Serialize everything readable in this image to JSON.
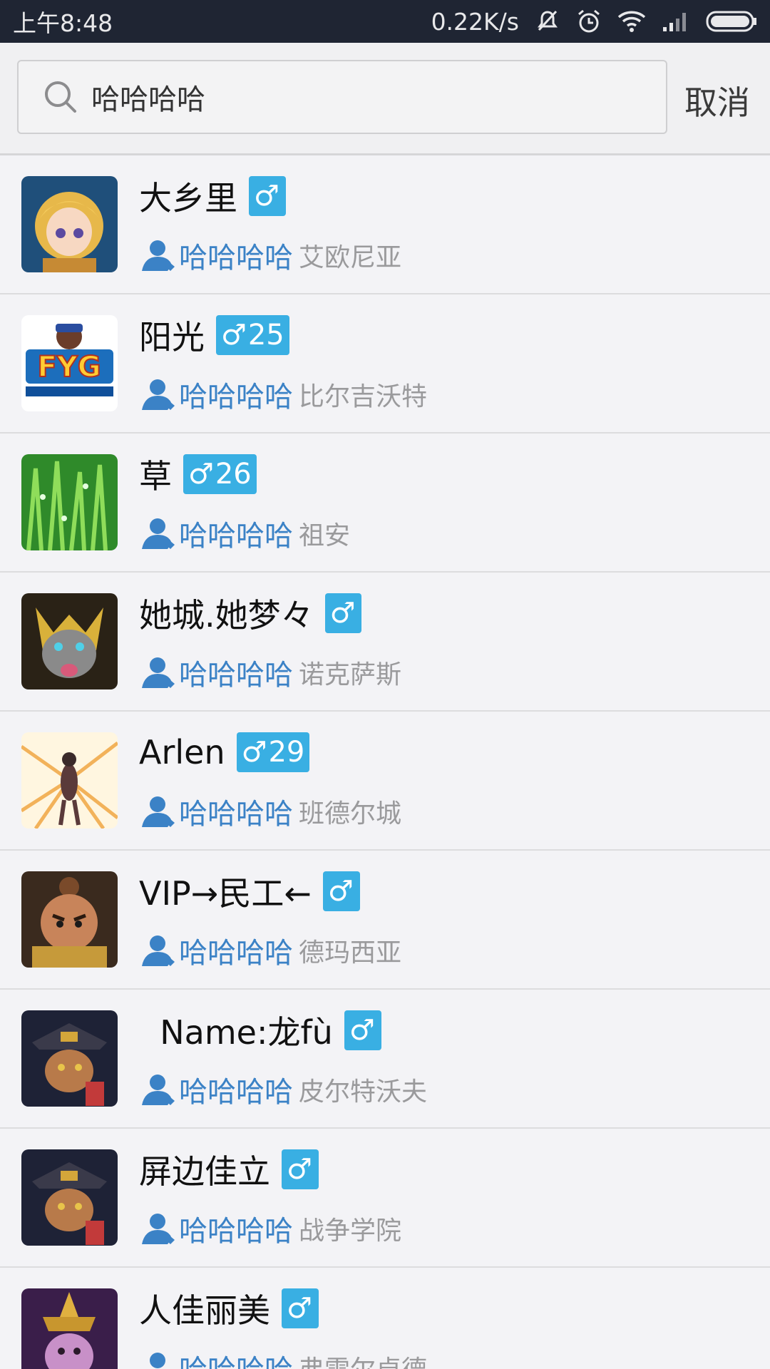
{
  "status_bar": {
    "time": "上午8:48",
    "speed": "0.22K/s",
    "icons": [
      "mute-icon",
      "alarm-icon",
      "wifi-icon",
      "signal-icon",
      "battery-icon"
    ]
  },
  "search": {
    "value": "哈哈哈哈",
    "placeholder": "哈哈哈哈",
    "cancel_label": "取消"
  },
  "colors": {
    "badge": "#39afe3",
    "tag": "#3b82c6",
    "region": "#9a9a9c"
  },
  "results": [
    {
      "name": "大乡里",
      "gender": "♂",
      "age": "",
      "tag": "哈哈哈哈",
      "region": "艾欧尼亚",
      "avatar": "avatar-blonde-girl"
    },
    {
      "name": "阳光",
      "gender": "♂",
      "age": "25",
      "tag": "哈哈哈哈",
      "region": "比尔吉沃特",
      "avatar": "avatar-fyg-logo"
    },
    {
      "name": "草",
      "gender": "♂",
      "age": "26",
      "tag": "哈哈哈哈",
      "region": "祖安",
      "avatar": "avatar-grass"
    },
    {
      "name": "她城.她梦々",
      "gender": "♂",
      "age": "",
      "tag": "哈哈哈哈",
      "region": "诺克萨斯",
      "avatar": "avatar-jackal-warrior"
    },
    {
      "name": "Arlen",
      "gender": "♂",
      "age": "29",
      "tag": "哈哈哈哈",
      "region": "班德尔城",
      "avatar": "avatar-robot-sunburst"
    },
    {
      "name": "VIP→民工←",
      "gender": "♂",
      "age": "",
      "tag": "哈哈哈哈",
      "region": "德玛西亚",
      "avatar": "avatar-monk-kid"
    },
    {
      "name": "  Name:龙fù",
      "gender": "♂",
      "age": "",
      "tag": "哈哈哈哈",
      "region": "皮尔特沃夫",
      "avatar": "avatar-card-master"
    },
    {
      "name": "屏边佳立",
      "gender": "♂",
      "age": "",
      "tag": "哈哈哈哈",
      "region": "战争学院",
      "avatar": "avatar-card-master"
    },
    {
      "name": "人佳丽美",
      "gender": "♂",
      "age": "",
      "tag": "哈哈哈哈",
      "region": "弗雷尔卓德",
      "avatar": "avatar-golden-warrior"
    }
  ]
}
